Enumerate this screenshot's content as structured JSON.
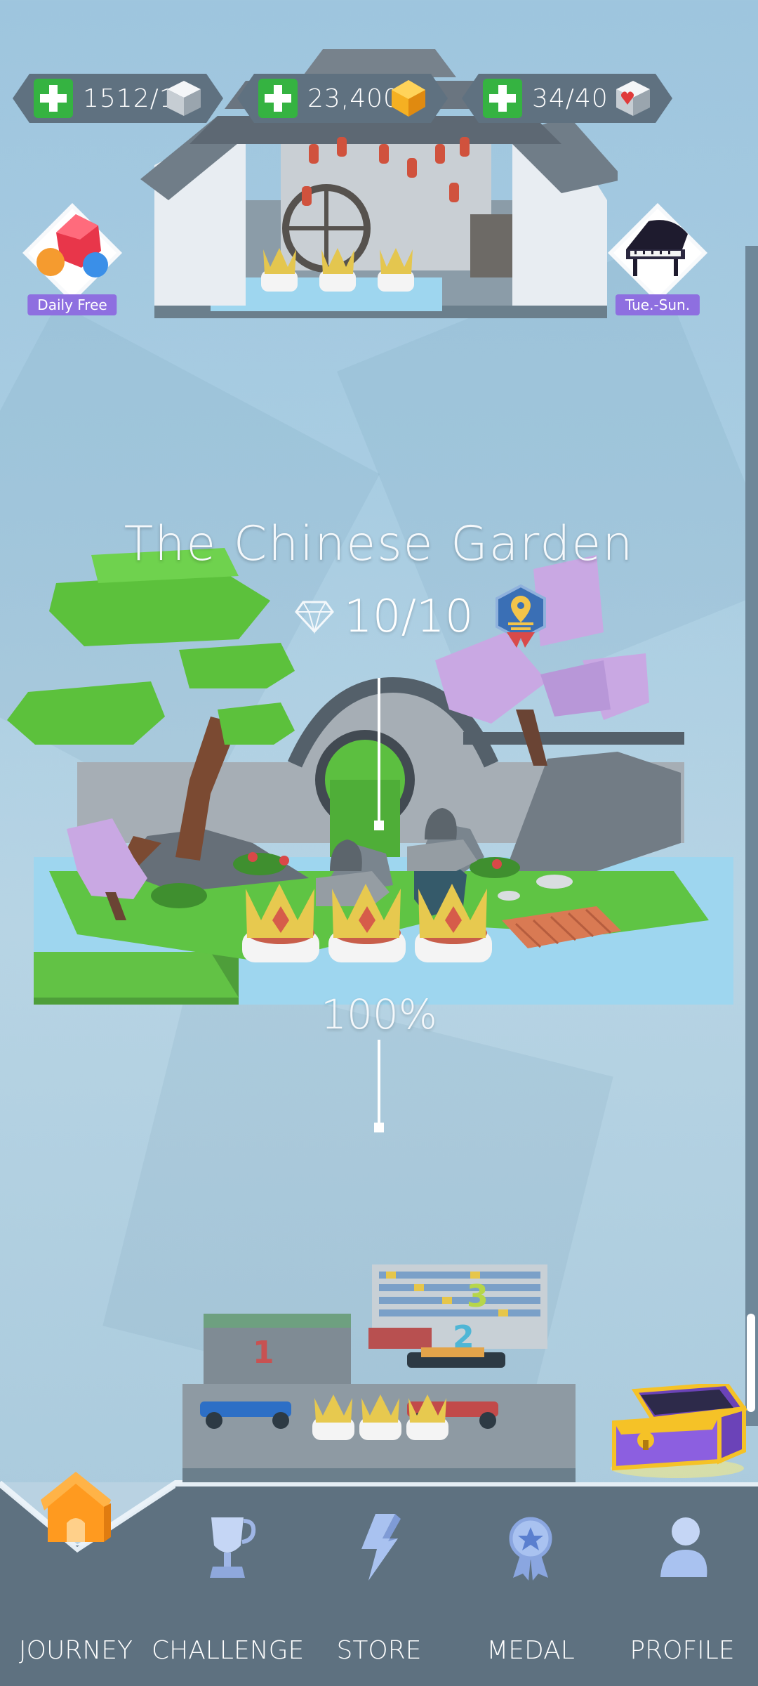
{
  "resources": {
    "lives": {
      "value": "1512/15",
      "icon": "cube-icon"
    },
    "coins": {
      "value": "23,400",
      "icon": "gold-gem-icon"
    },
    "keys": {
      "value": "34/40",
      "icon": "heart-cube-icon"
    }
  },
  "side_buttons": {
    "daily_free": "Daily Free",
    "event": "Tue.-Sun."
  },
  "level": {
    "title": "The Chinese Garden",
    "gems": "10/10",
    "progress": "100%",
    "progress_value": 100
  },
  "nav": {
    "items": [
      {
        "label": "JOURNEY",
        "icon": "house-icon",
        "active": true
      },
      {
        "label": "CHALLENGE",
        "icon": "trophy-icon",
        "active": false
      },
      {
        "label": "STORE",
        "icon": "lightning-icon",
        "active": false
      },
      {
        "label": "MEDAL",
        "icon": "medal-icon",
        "active": false
      },
      {
        "label": "PROFILE",
        "icon": "person-icon",
        "active": false
      }
    ]
  },
  "colors": {
    "accent_green": "#35b341",
    "nav_bg": "#5e7180",
    "purple": "#8e6fe0",
    "gold": "#f5b022"
  }
}
